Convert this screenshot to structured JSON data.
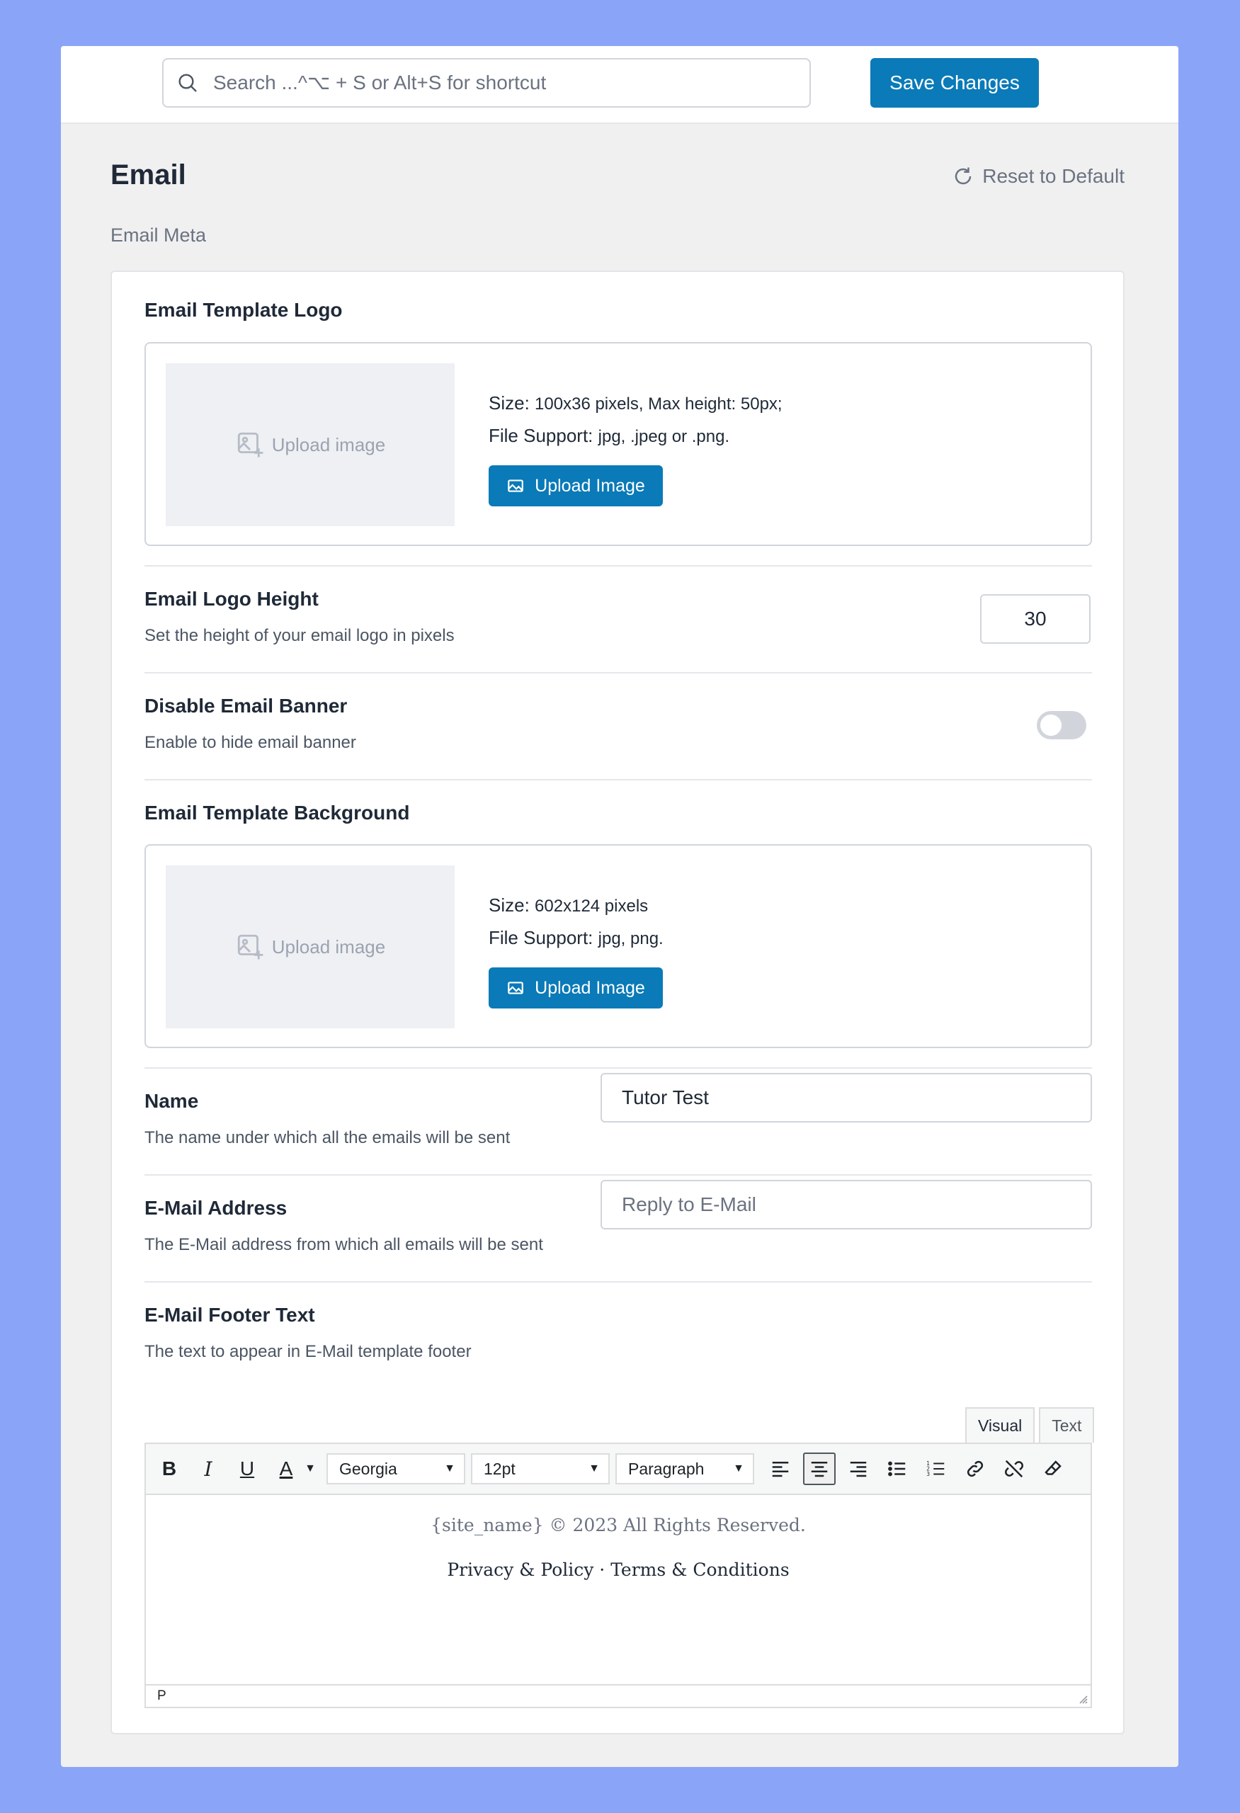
{
  "topbar": {
    "search_placeholder": "Search ...^⌥ + S or Alt+S for shortcut",
    "save_label": "Save Changes"
  },
  "page": {
    "title": "Email",
    "reset_label": "Reset to Default",
    "section_label": "Email Meta"
  },
  "logo": {
    "title": "Email Template Logo",
    "upload_area_label": "Upload image",
    "size_label": "Size:",
    "size_value": "100x36 pixels, Max height: 50px;",
    "support_label": "File Support:",
    "support_value": "jpg, .jpeg or .png.",
    "button_label": "Upload Image"
  },
  "logo_height": {
    "title": "Email Logo Height",
    "desc": "Set the height of your email logo in pixels",
    "value": "30"
  },
  "banner": {
    "title": "Disable Email Banner",
    "desc": "Enable to hide email banner",
    "enabled": false
  },
  "background": {
    "title": "Email Template Background",
    "upload_area_label": "Upload image",
    "size_label": "Size:",
    "size_value": "602x124 pixels",
    "support_label": "File Support:",
    "support_value": "jpg, png.",
    "button_label": "Upload Image"
  },
  "name": {
    "title": "Name",
    "desc": "The name under which all the emails will be sent",
    "value": "Tutor Test"
  },
  "email": {
    "title": "E-Mail Address",
    "desc": "The E-Mail address from which all emails will be sent",
    "placeholder": "Reply to E-Mail"
  },
  "footer": {
    "title": "E-Mail Footer Text",
    "desc": "The text to appear in E-Mail template footer",
    "tabs": [
      "Visual",
      "Text"
    ],
    "toolbar": {
      "bold": "B",
      "italic": "I",
      "underline": "U",
      "text_color": "A",
      "font_family": "Georgia",
      "font_size": "12pt",
      "block_format": "Paragraph"
    },
    "content_line1": "{site_name} © 2023 All Rights Reserved.",
    "content_line2": "Privacy & Policy · Terms & Conditions",
    "status_path": "P"
  },
  "colors": {
    "primary": "#0a7ab8",
    "backdrop": "#8aa4f8"
  }
}
